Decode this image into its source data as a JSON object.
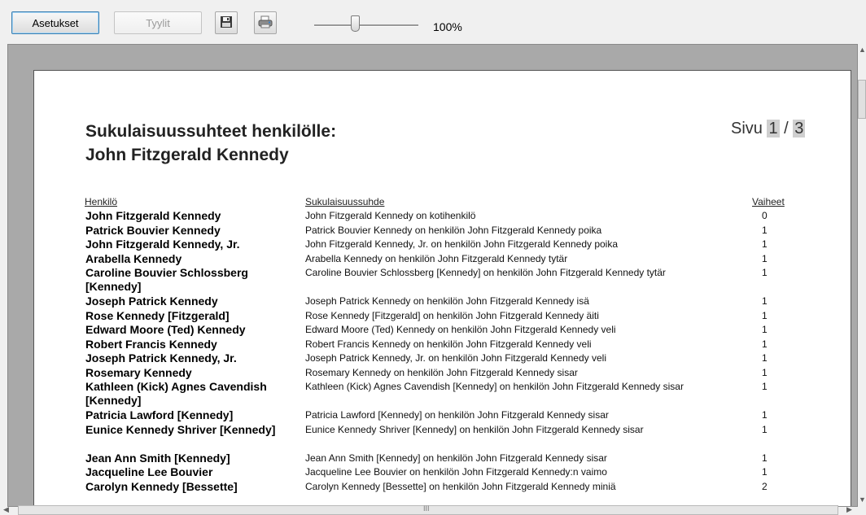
{
  "toolbar": {
    "settings_label": "Asetukset",
    "styles_label": "Tyylit",
    "zoom_value": "100%",
    "zoom_slider_fraction": 0.39
  },
  "report": {
    "title_line1": "Sukulaisuussuhteet henkilölle:",
    "title_line2": "John Fitzgerald Kennedy",
    "page_label": "Sivu",
    "page_current": "1",
    "page_separator": "/",
    "page_total": "3",
    "headers": {
      "person": "Henkilö",
      "relation": "Sukulaisuussuhde",
      "steps": "Vaiheet"
    },
    "rows": [
      {
        "person": "John Fitzgerald Kennedy",
        "relation": "John Fitzgerald Kennedy on kotihenkilö",
        "steps": "0"
      },
      {
        "person": "Patrick Bouvier Kennedy",
        "relation": "Patrick Bouvier Kennedy on henkilön John Fitzgerald Kennedy poika",
        "steps": "1"
      },
      {
        "person": "John Fitzgerald Kennedy, Jr.",
        "relation": "John Fitzgerald Kennedy, Jr. on henkilön John Fitzgerald Kennedy poika",
        "steps": "1"
      },
      {
        "person": "Arabella Kennedy",
        "relation": "Arabella Kennedy on henkilön John Fitzgerald Kennedy tytär",
        "steps": "1"
      },
      {
        "person": "Caroline Bouvier Schlossberg [Kennedy]",
        "relation": "Caroline Bouvier Schlossberg [Kennedy] on henkilön John Fitzgerald Kennedy tytär",
        "steps": "1"
      },
      {
        "person": "Joseph Patrick Kennedy",
        "relation": "Joseph Patrick Kennedy on henkilön John Fitzgerald Kennedy isä",
        "steps": "1"
      },
      {
        "person": "Rose Kennedy [Fitzgerald]",
        "relation": "Rose Kennedy [Fitzgerald] on henkilön John Fitzgerald Kennedy äiti",
        "steps": "1"
      },
      {
        "person": "Edward Moore (Ted) Kennedy",
        "relation": "Edward Moore (Ted) Kennedy on henkilön John Fitzgerald Kennedy veli",
        "steps": "1"
      },
      {
        "person": "Robert Francis Kennedy",
        "relation": "Robert Francis Kennedy on henkilön John Fitzgerald Kennedy veli",
        "steps": "1"
      },
      {
        "person": "Joseph Patrick Kennedy, Jr.",
        "relation": "Joseph Patrick Kennedy, Jr. on henkilön John Fitzgerald Kennedy veli",
        "steps": "1"
      },
      {
        "person": "Rosemary Kennedy",
        "relation": "Rosemary Kennedy on henkilön John Fitzgerald Kennedy sisar",
        "steps": "1"
      },
      {
        "person": "Kathleen (Kick) Agnes Cavendish [Kennedy]",
        "relation": "Kathleen (Kick) Agnes Cavendish [Kennedy] on henkilön John Fitzgerald Kennedy sisar",
        "steps": "1"
      },
      {
        "person": "Patricia Lawford [Kennedy]",
        "relation": "Patricia Lawford [Kennedy] on henkilön John Fitzgerald Kennedy sisar",
        "steps": "1"
      },
      {
        "person": "Eunice Kennedy Shriver [Kennedy]",
        "relation": "Eunice Kennedy Shriver [Kennedy] on henkilön John Fitzgerald Kennedy sisar",
        "steps": "1"
      },
      {
        "person": "Jean Ann Smith [Kennedy]",
        "relation": "Jean Ann Smith [Kennedy] on henkilön John Fitzgerald Kennedy sisar",
        "steps": "1"
      },
      {
        "person": "Jacqueline Lee Bouvier",
        "relation": "Jacqueline Lee Bouvier on henkilön John Fitzgerald Kennedy:n vaimo",
        "steps": "1"
      },
      {
        "person": "Carolyn Kennedy [Bessette]",
        "relation": "Carolyn Kennedy [Bessette] on henkilön John Fitzgerald Kennedy miniä",
        "steps": "2"
      }
    ]
  },
  "icons": {
    "save": "save-icon",
    "print": "print-icon"
  },
  "scrollbar": {
    "grip_label": "III"
  }
}
